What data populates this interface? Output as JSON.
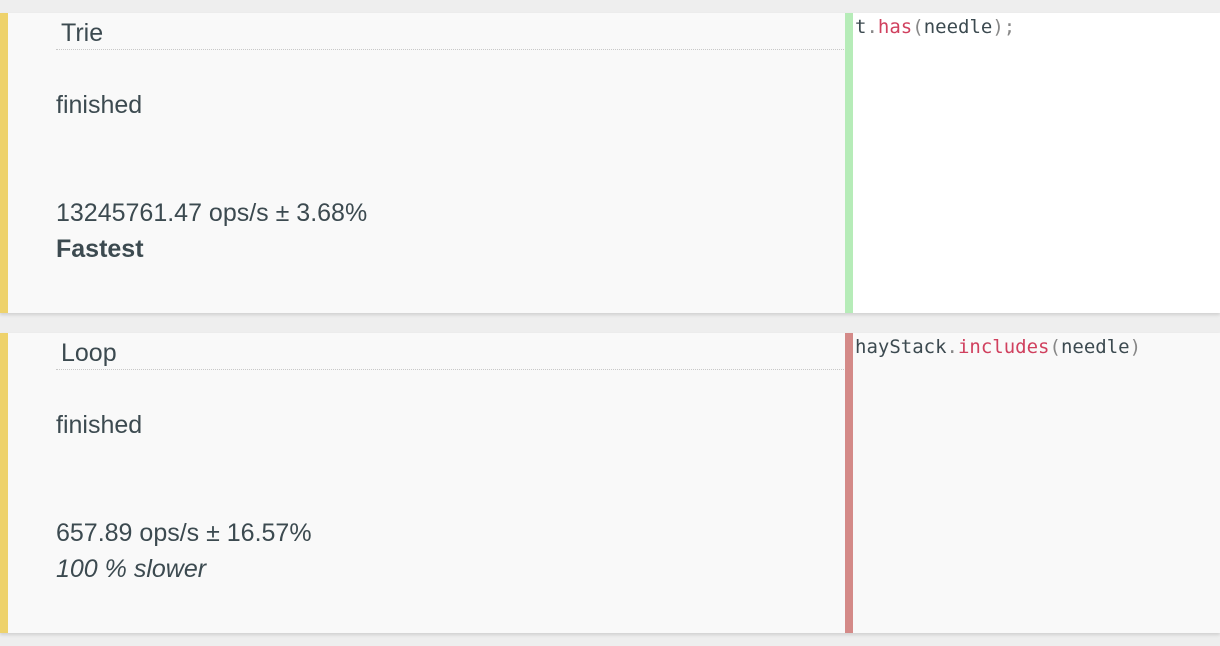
{
  "colors": {
    "left_accent": "#eed26b",
    "fastest_bar": "#b6ecb8",
    "slower_bar": "#d48a88",
    "code_property": "#d0405e"
  },
  "tests": [
    {
      "title": "Trie",
      "status": "finished",
      "ops": "13245761.47 ops/s ± 3.68%",
      "verdict": "Fastest",
      "code": {
        "obj": "t",
        "dot": ".",
        "method": "has",
        "open": "(",
        "arg": "needle",
        "close": ");"
      }
    },
    {
      "title": "Loop",
      "status": "finished",
      "ops": "657.89 ops/s ± 16.57%",
      "verdict": "100 % slower",
      "code": {
        "obj": "hayStack",
        "dot": ".",
        "method": "includes",
        "open": "(",
        "arg": "needle",
        "close": ")"
      }
    }
  ]
}
